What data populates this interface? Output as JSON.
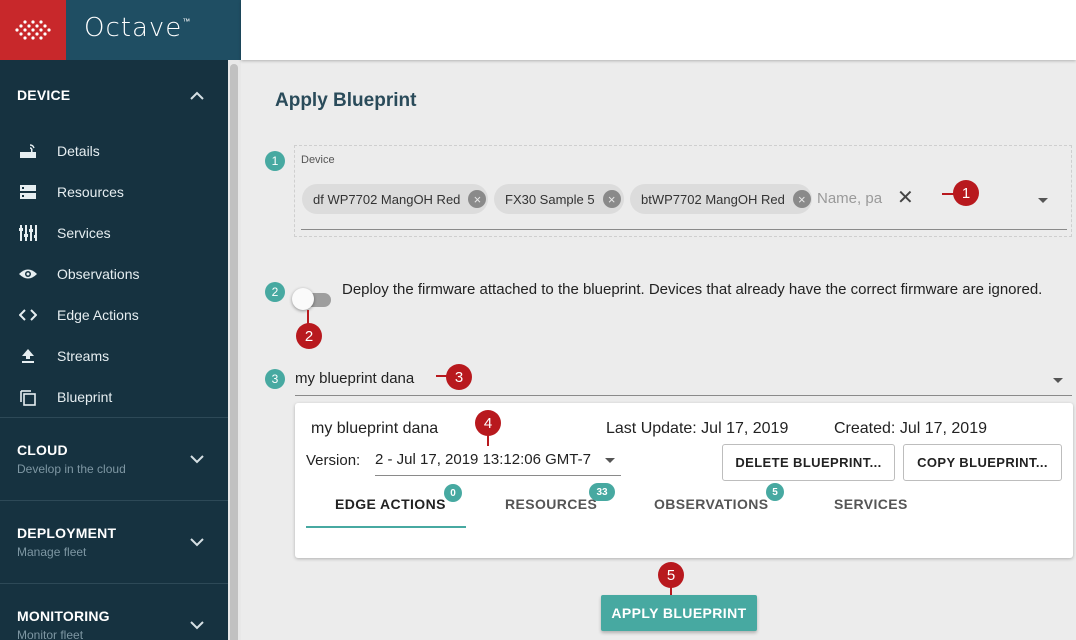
{
  "brand": {
    "name": "Octave",
    "trademark": "™"
  },
  "sidebar": {
    "device": {
      "title": "DEVICE",
      "items": [
        {
          "label": "Details",
          "icon": "router-icon"
        },
        {
          "label": "Resources",
          "icon": "storage-icon"
        },
        {
          "label": "Services",
          "icon": "sliders-icon"
        },
        {
          "label": "Observations",
          "icon": "eye-icon"
        },
        {
          "label": "Edge Actions",
          "icon": "code-icon"
        },
        {
          "label": "Streams",
          "icon": "upload-icon"
        },
        {
          "label": "Blueprint",
          "icon": "copy-icon"
        }
      ]
    },
    "cloud": {
      "title": "CLOUD",
      "subtitle": "Develop in the cloud"
    },
    "deployment": {
      "title": "DEPLOYMENT",
      "subtitle": "Manage fleet"
    },
    "monitoring": {
      "title": "MONITORING",
      "subtitle": "Monitor fleet"
    }
  },
  "main": {
    "title": "Apply Blueprint",
    "steps": [
      "1",
      "2",
      "3"
    ],
    "device_field": {
      "label": "Device",
      "chips": [
        "df WP7702 MangOH Red",
        "FX30 Sample 5",
        "btWP7702 MangOH Red"
      ],
      "placeholder": "Name, pa"
    },
    "firmware_text": "Deploy the firmware attached to the blueprint. Devices that already have the correct firmware are ignored.",
    "firmware_toggle_on": false,
    "blueprint_select": "my blueprint dana",
    "card": {
      "name": "my blueprint dana",
      "last_update": "Last Update: Jul 17, 2019",
      "created": "Created: Jul 17, 2019",
      "version_label": "Version:",
      "version_value": "2 - Jul 17, 2019 13:12:06 GMT-7",
      "delete_label": "DELETE BLUEPRINT...",
      "copy_label": "COPY BLUEPRINT...",
      "tabs": [
        {
          "label": "EDGE ACTIONS",
          "badge": "0"
        },
        {
          "label": "RESOURCES",
          "badge": "33"
        },
        {
          "label": "OBSERVATIONS",
          "badge": "5"
        },
        {
          "label": "SERVICES",
          "badge": ""
        }
      ]
    },
    "apply_label": "APPLY BLUEPRINT",
    "callouts": [
      "1",
      "2",
      "3",
      "4",
      "5"
    ]
  },
  "colors": {
    "teal": "#47a9a1",
    "callout_red": "#b8191e",
    "sidebar_bg": "#163240",
    "brand_red": "#c8282b",
    "brand_blue": "#1f4e63"
  }
}
